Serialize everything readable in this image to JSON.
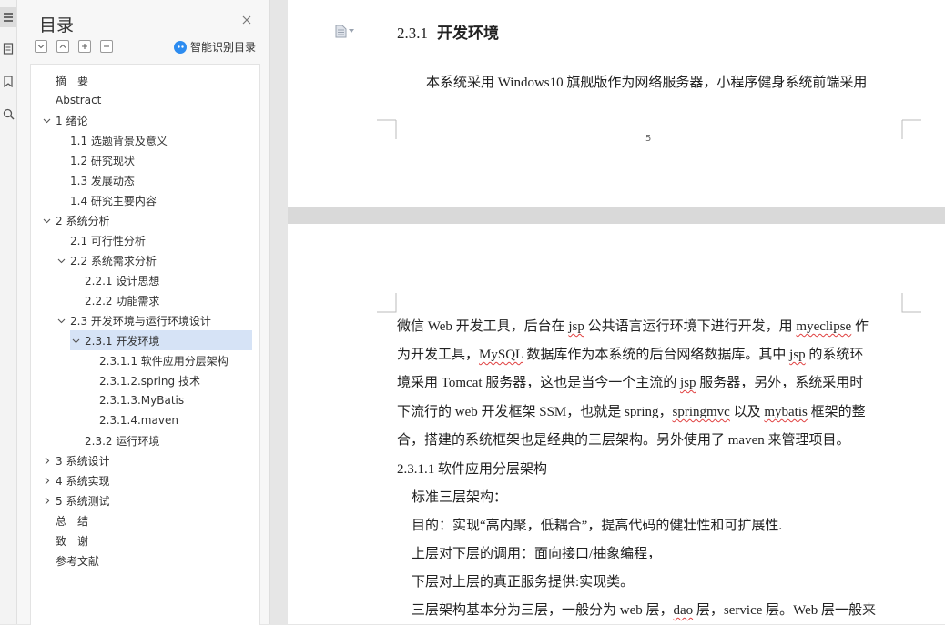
{
  "toc": {
    "title": "目录",
    "smart_label": "智能识别目录",
    "items": [
      {
        "label": "摘　要"
      },
      {
        "label": "Abstract"
      },
      {
        "label": "1 绪论"
      },
      {
        "label": "1.1 选题背景及意义"
      },
      {
        "label": "1.2 研究现状"
      },
      {
        "label": "1.3 发展动态"
      },
      {
        "label": "1.4 研究主要内容"
      },
      {
        "label": "2 系统分析"
      },
      {
        "label": "2.1 可行性分析"
      },
      {
        "label": "2.2  系统需求分析"
      },
      {
        "label": "2.2.1  设计思想"
      },
      {
        "label": "2.2.2  功能需求"
      },
      {
        "label": "2.3  开发环境与运行环境设计"
      },
      {
        "label": "2.3.1  开发环境"
      },
      {
        "label": "2.3.1.1 软件应用分层架构"
      },
      {
        "label": "2.3.1.2.spring 技术"
      },
      {
        "label": "2.3.1.3.MyBatis"
      },
      {
        "label": "2.3.1.4.maven"
      },
      {
        "label": "2.3.2  运行环境"
      },
      {
        "label": "3 系统设计"
      },
      {
        "label": "4 系统实现"
      },
      {
        "label": "5 系统测试"
      },
      {
        "label": "总　结"
      },
      {
        "label": "致　谢"
      },
      {
        "label": "参考文献"
      }
    ]
  },
  "doc": {
    "heading_num": "2.3.1",
    "heading_text": "开发环境",
    "p1": "本系统采用 Windows10 旗舰版作为网络服务器，小程序健身系统前端采用",
    "page_number": "5",
    "l1a": "微信 Web 开发工具，后台在 ",
    "l1b": "jsp",
    "l1c": " 公共语言运行环境下进行开发，用 ",
    "l1d": "myeclipse",
    "l1e": " 作",
    "l2a": "为开发工具，",
    "l2b": "MySQL",
    "l2c": " 数据库作为本系统的后台网络数据库。其中 ",
    "l2d": "jsp",
    "l2e": " 的系统环",
    "l3a": "境采用 Tomcat 服务器，这也是当今一个主流的 ",
    "l3b": "jsp",
    "l3c": " 服务器，另外，系统采用时",
    "l4a": "下流行的 web 开发框架 SSM，也就是 spring，",
    "l4b": "springmvc",
    "l4c": " 以及 ",
    "l4d": "mybatis",
    "l4e": " 框架的整",
    "l5": "合，搭建的系统框架也是经典的三层架构。另外使用了 maven 来管理项目。",
    "sub_heading": "2.3.1.1 软件应用分层架构",
    "b1": "标准三层架构：",
    "b2": "目的：实现“高内聚，低耦合”，提高代码的健壮性和可扩展性.",
    "b3": "上层对下层的调用：面向接口/抽象编程，",
    "b4": "下层对上层的真正服务提供:实现类。",
    "b5a": "三层架构基本分为三层，一般分为 web 层，",
    "b5b": "dao",
    "b5c": " 层，service 层。Web 层一般来"
  }
}
